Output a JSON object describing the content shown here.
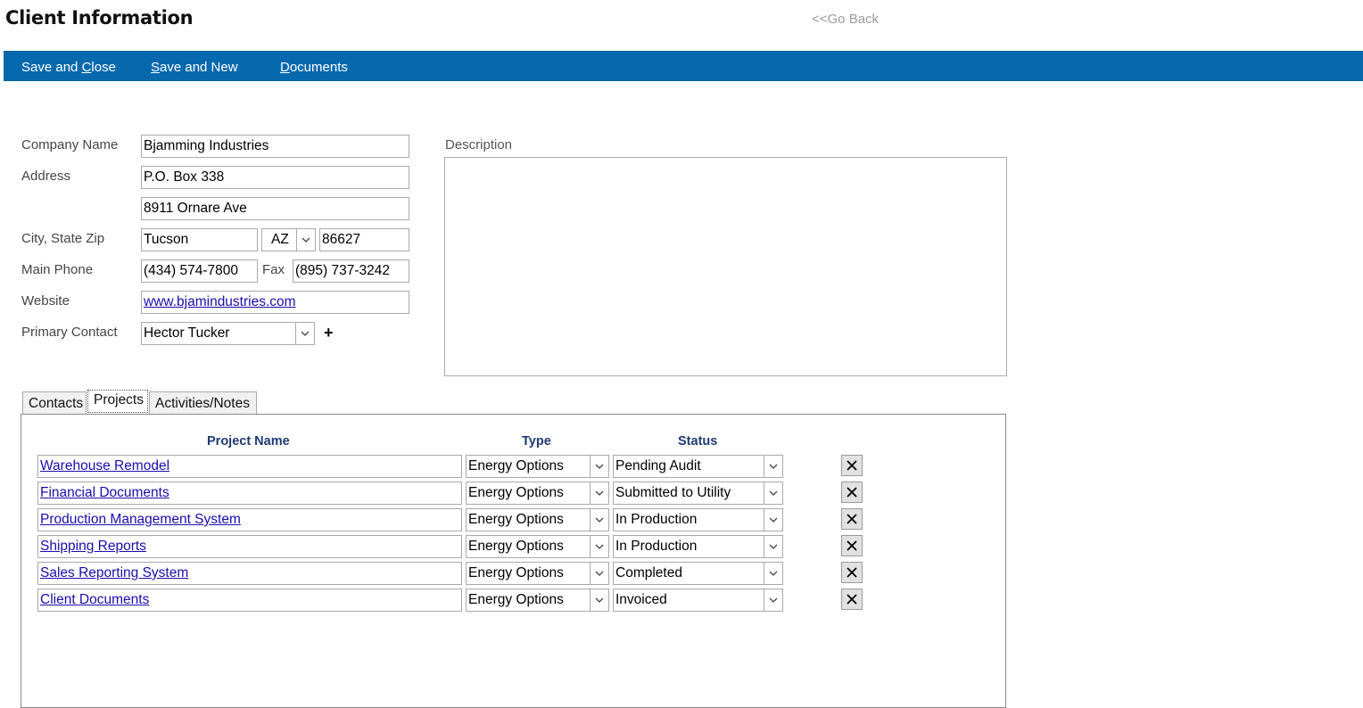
{
  "header": {
    "title": "Client Information",
    "go_back": "<<Go Back"
  },
  "toolbar": {
    "color": "#0769ad",
    "buttons": [
      {
        "label": "Save and Close",
        "pre": "Save and ",
        "key": "C",
        "post": "lose"
      },
      {
        "label": "Save and New",
        "pre": "",
        "key": "S",
        "post": "ave and New"
      },
      {
        "label": "Documents",
        "pre": "",
        "key": "D",
        "post": "ocuments"
      }
    ]
  },
  "form": {
    "company_name": {
      "label": "Company Name",
      "value": "Bjamming Industries"
    },
    "address": {
      "label": "Address",
      "line1": "P.O. Box 338",
      "line2": "8911 Ornare Ave"
    },
    "city_state_zip": {
      "label": "City, State Zip",
      "city": "Tucson",
      "state": "AZ",
      "zip": "86627"
    },
    "main_phone": {
      "label": "Main Phone",
      "value": "(434) 574-7800"
    },
    "fax": {
      "label": "Fax",
      "value": "(895) 737-3242"
    },
    "website": {
      "label": "Website",
      "value": "www.bjamindustries.com"
    },
    "primary_contact": {
      "label": "Primary Contact",
      "value": "Hector Tucker",
      "add_icon": "plus-icon"
    },
    "description": {
      "label": "Description",
      "value": ""
    }
  },
  "tabs": [
    {
      "label": "Contacts",
      "active": false
    },
    {
      "label": "Projects",
      "active": true
    },
    {
      "label": "Activities/Notes",
      "active": false
    }
  ],
  "projects": {
    "columns": {
      "name": "Project Name",
      "type": "Type",
      "status": "Status"
    },
    "rows": [
      {
        "name": "Warehouse Remodel",
        "type": "Energy Options",
        "status": "Pending Audit"
      },
      {
        "name": "Financial Documents",
        "type": "Energy Options",
        "status": "Submitted to Utility"
      },
      {
        "name": "Production Management System",
        "type": "Energy Options",
        "status": "In Production"
      },
      {
        "name": "Shipping Reports",
        "type": "Energy Options",
        "status": "In Production"
      },
      {
        "name": "Sales Reporting System",
        "type": "Energy Options",
        "status": "Completed"
      },
      {
        "name": "Client Documents",
        "type": "Energy Options",
        "status": "Invoiced"
      }
    ],
    "delete_icon": "close-icon"
  }
}
